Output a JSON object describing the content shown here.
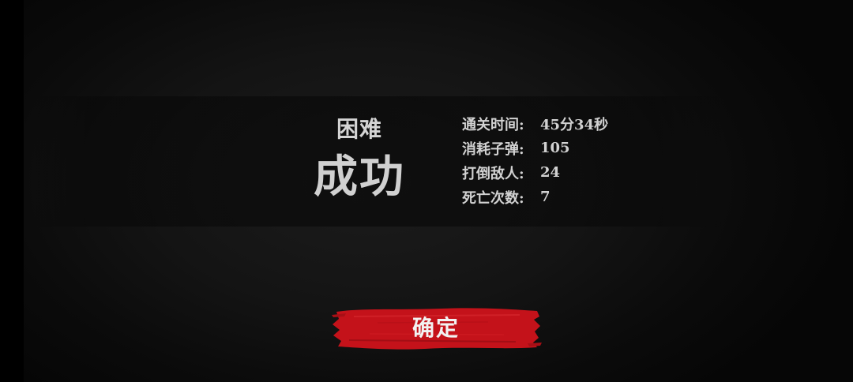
{
  "result": {
    "difficulty": "困难",
    "outcome": "成功"
  },
  "stats": [
    {
      "label": "通关时间:",
      "value": "45分34秒"
    },
    {
      "label": "消耗子弹:",
      "value": "105"
    },
    {
      "label": "打倒敌人:",
      "value": "24"
    },
    {
      "label": "死亡次数:",
      "value": "7"
    }
  ],
  "confirm_button": {
    "label": "确定"
  },
  "colors": {
    "button_red": "#c4121a",
    "text": "#d2d2d2",
    "background": "#141414"
  }
}
